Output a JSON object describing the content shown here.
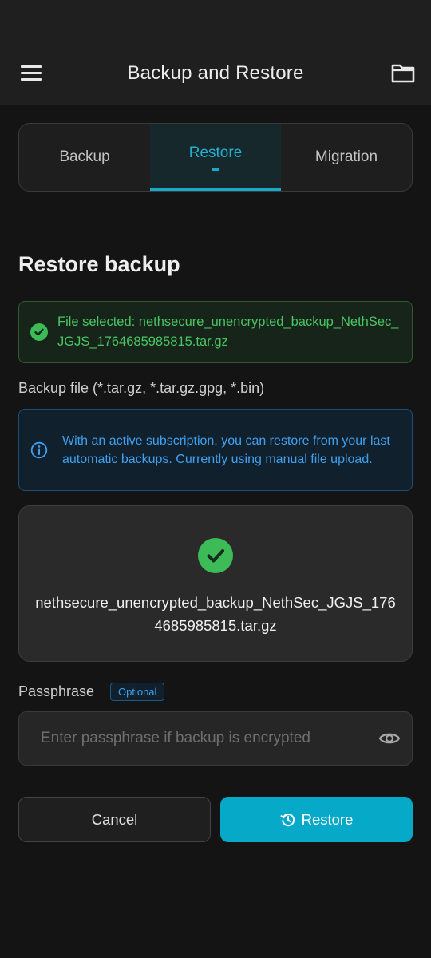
{
  "app_bar": {
    "title": "Backup and Restore",
    "menu_icon": "hamburger-menu-icon",
    "folder_icon": "folder-icon"
  },
  "tabs": [
    {
      "label": "Backup",
      "active": false
    },
    {
      "label": "Restore",
      "active": true
    },
    {
      "label": "Migration",
      "active": false
    }
  ],
  "section_title": "Restore backup",
  "success_banner": {
    "icon": "check-circle-icon",
    "text": "File selected: nethsecure_unencrypted_backup_NethSec_JGJS_1764685985815.tar.gz"
  },
  "backup_file_label": "Backup file (*.tar.gz, *.tar.gz.gpg, *.bin)",
  "info_banner": {
    "icon": "info-icon",
    "text": "With an active subscription, you can restore from your last automatic backups. Currently using manual file upload."
  },
  "file_card": {
    "icon": "check-circle-icon",
    "filename": "nethsecure_unencrypted_backup_NethSec_JGJS_1764685985815.tar.gz"
  },
  "passphrase": {
    "label": "Passphrase",
    "badge": "Optional",
    "placeholder": "Enter passphrase if backup is encrypted",
    "value": "",
    "toggle_icon": "eye-icon"
  },
  "buttons": {
    "cancel": "Cancel",
    "restore": "Restore",
    "restore_icon": "restore-history-icon"
  },
  "colors": {
    "accent": "#06aac8",
    "success": "#3dbb57",
    "info": "#3fa0f0",
    "background": "#141414"
  }
}
